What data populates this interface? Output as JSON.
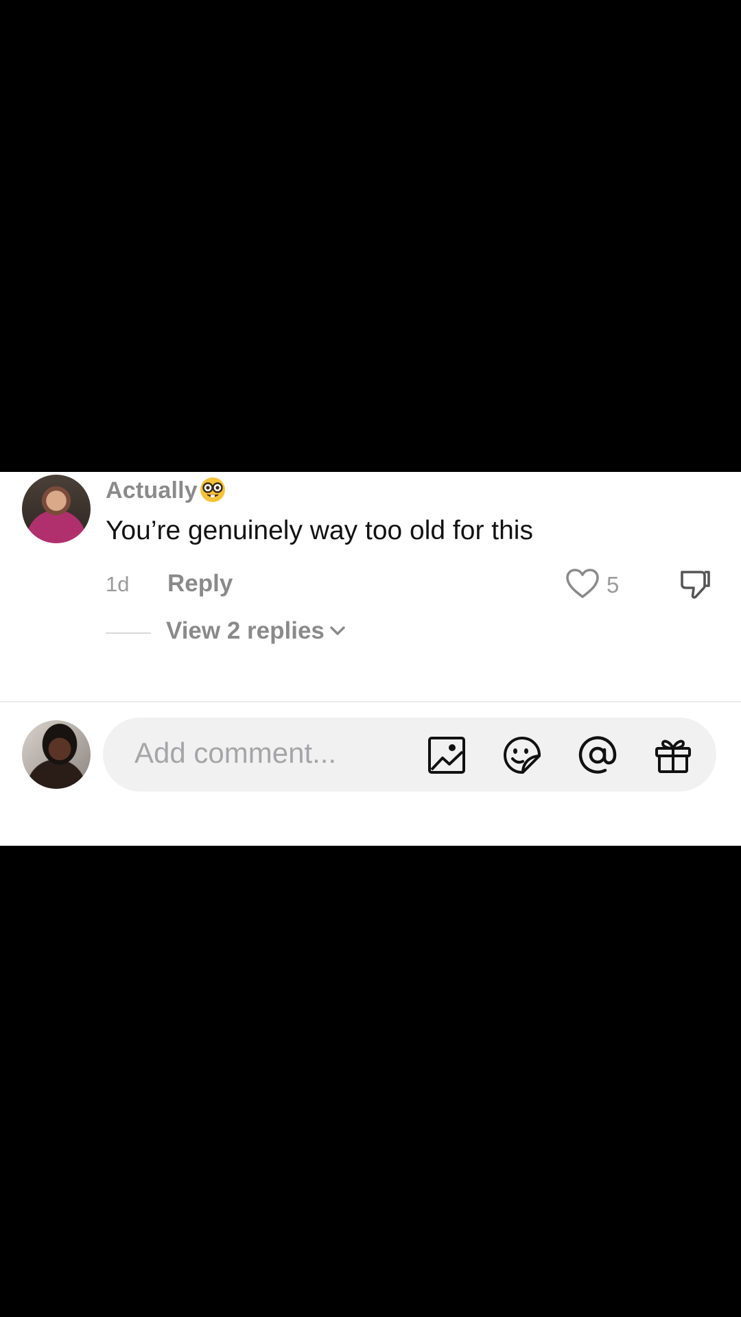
{
  "comment": {
    "username": "Actually",
    "username_emoji": "nerd-face-emoji",
    "text": "You’re genuinely way too old for this",
    "time": "1d",
    "reply_label": "Reply",
    "like_count": "5",
    "view_replies_label": "View 2 replies"
  },
  "composer": {
    "placeholder": "Add comment...",
    "icons": [
      "image-icon",
      "sticker-icon",
      "mention-icon",
      "gift-icon"
    ]
  },
  "colors": {
    "background": "#000000",
    "panel": "#ffffff",
    "input_bg": "#f1f1f2",
    "muted_text": "#8a8a8a"
  }
}
